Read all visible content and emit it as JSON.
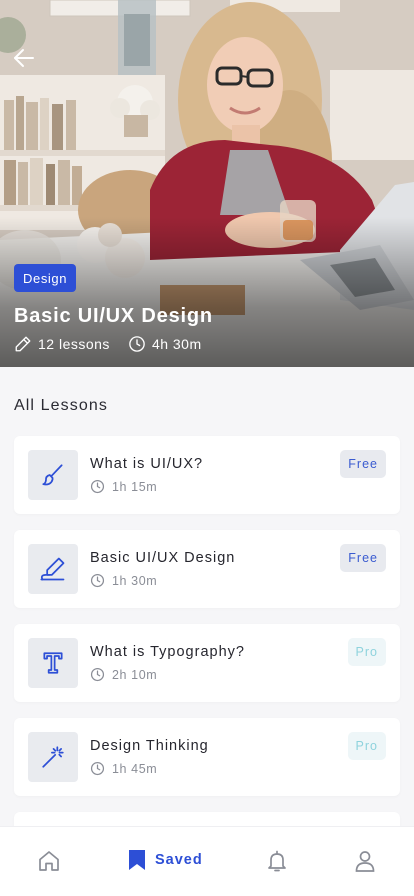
{
  "hero": {
    "category": "Design",
    "title": "Basic UI/UX Design",
    "lessons_count": "12 lessons",
    "duration": "4h 30m"
  },
  "section_title": "All Lessons",
  "lessons": [
    {
      "title": "What is UI/UX?",
      "duration": "1h 15m",
      "tag": "Free",
      "icon": "brush-icon"
    },
    {
      "title": "Basic UI/UX Design",
      "duration": "1h 30m",
      "tag": "Free",
      "icon": "pen-icon"
    },
    {
      "title": "What is Typography?",
      "duration": "2h 10m",
      "tag": "Pro",
      "icon": "typography-icon"
    },
    {
      "title": "Design Thinking",
      "duration": "1h 45m",
      "tag": "Pro",
      "icon": "magic-wand-icon"
    }
  ],
  "tabbar": {
    "items": [
      {
        "name": "home-icon"
      },
      {
        "name": "bookmark-icon",
        "label": "Saved",
        "active": true
      },
      {
        "name": "bell-icon"
      },
      {
        "name": "user-icon"
      }
    ]
  },
  "colors": {
    "accent": "#2d4fd6",
    "free_tag_bg": "#e8eaef",
    "pro_tag_text": "#8fd3dd",
    "background": "#f6f6f8"
  }
}
